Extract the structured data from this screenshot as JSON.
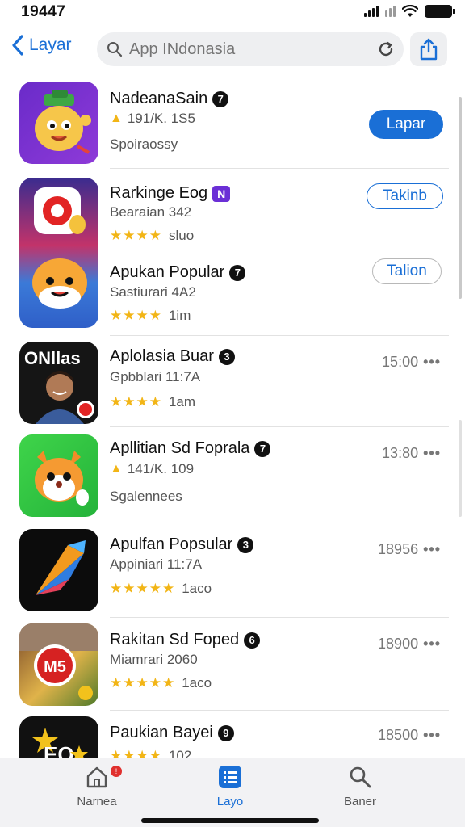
{
  "status_bar": {
    "time": "19447"
  },
  "nav": {
    "back_label": "Layar",
    "search_placeholder": "App INdonasia"
  },
  "apps": [
    {
      "name": "NadeanaSain",
      "badge": "7",
      "sub": "191/K. 1S5",
      "meta": "Spoiraossy",
      "action": "Lapar"
    },
    {
      "name": "Rarkinge Eog",
      "badge": "N",
      "sub": "Bearaian 342",
      "stars": "★★★★",
      "meta": "sluo",
      "action": "Takinb"
    },
    {
      "name": "Apukan Popular",
      "badge": "7",
      "sub": "Sastiurari 4A2",
      "stars": "★★★★",
      "meta": "1im",
      "action": "Talion"
    },
    {
      "name": "Aplolasia Buar",
      "badge": "3",
      "sub": "Gpbblari 11:7A",
      "stars": "★★★★",
      "meta": "1am",
      "time": "15:00",
      "icon_text": "ONllas"
    },
    {
      "name": "Apllitian Sd Foprala",
      "badge": "7",
      "sub": "141/K. 109",
      "meta": "Sgalennees",
      "time": "13:80"
    },
    {
      "name": "Apulfan Popsular",
      "badge": "3",
      "sub": "Appiniari 11:7A",
      "stars": "★★★★★",
      "meta": "1aco",
      "time": "18956"
    },
    {
      "name": "Rakitan Sd Foped",
      "badge": "6",
      "sub": "Miamrari 2060",
      "stars": "★★★★★",
      "meta": "1aco",
      "time": "18900",
      "icon_text": "M5"
    },
    {
      "name": "Paukian Bayei",
      "badge": "9",
      "sub": "102",
      "stars": "★★★★",
      "time": "18500",
      "icon_text": "EO"
    }
  ],
  "more_glyph": "•••",
  "tabs": [
    {
      "label": "Narnea"
    },
    {
      "label": "Layo"
    },
    {
      "label": "Baner"
    }
  ],
  "colors": {
    "accent": "#1a6fd6",
    "star": "#f2b516"
  }
}
